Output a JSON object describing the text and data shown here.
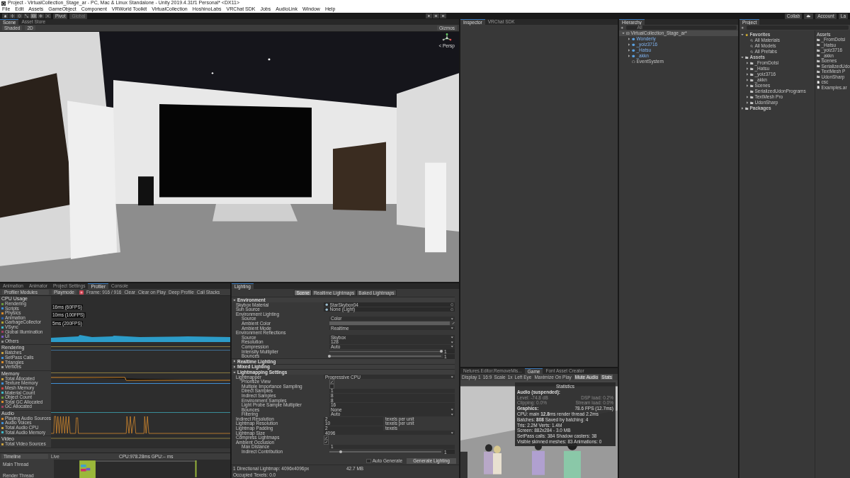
{
  "window": {
    "title": "Project - VirtualCollection_Stage_ar - PC, Mac & Linux Standalone - Unity 2019.4.31f1 Personal* <DX11>"
  },
  "menu": [
    "File",
    "Edit",
    "Assets",
    "GameObject",
    "Component",
    "VRWorld Toolkit",
    "VirtualCollection",
    "HoshinoLabs",
    "VRChat SDK",
    "Jobs",
    "AudioLink",
    "Window",
    "Help"
  ],
  "toolbar": {
    "tools": [
      {
        "kind": "hand",
        "selected": false
      },
      {
        "kind": "move",
        "selected": false
      },
      {
        "kind": "rotate",
        "selected": false
      },
      {
        "kind": "scale",
        "selected": false
      },
      {
        "kind": "rect",
        "selected": true
      },
      {
        "kind": "transform",
        "selected": false
      },
      {
        "kind": "custom",
        "selected": false
      }
    ],
    "pivot": "Pivot",
    "space": "Global",
    "collab": "Collab",
    "account": "Account",
    "layers": "La"
  },
  "scene": {
    "tabs": [
      {
        "label": "Scene",
        "selected": true
      },
      {
        "label": "Asset Store",
        "selected": false
      }
    ],
    "shading": "Shaded",
    "mode_2d": "2D",
    "gizmos": "Gizmos",
    "view": "< Persp"
  },
  "profiler": {
    "tabs": [
      {
        "label": "Animation",
        "selected": false
      },
      {
        "label": "Animator",
        "selected": false
      },
      {
        "label": "Project Settings",
        "selected": false
      },
      {
        "label": "Profiler",
        "selected": true
      },
      {
        "label": "Console",
        "selected": false
      }
    ],
    "toolbar": {
      "modules": "Profiler Modules",
      "target": "Playmode",
      "frame": "Frame: 916 / 916",
      "buttons": [
        "Clear",
        "Clear on Play",
        "Deep Profile",
        "Call Stacks"
      ]
    },
    "modules": [
      {
        "kind": "cpu",
        "title": "CPU Usage",
        "items": [
          {
            "label": "Rendering",
            "color": "#6b9a3c"
          },
          {
            "label": "Scripts",
            "color": "#3f8fd6"
          },
          {
            "label": "Physics",
            "color": "#d68a2c"
          },
          {
            "label": "Animation",
            "color": "#2a5fa8"
          },
          {
            "label": "GarbageCollector",
            "color": "#b0a030"
          },
          {
            "label": "VSync",
            "color": "#3fb8c8"
          },
          {
            "label": "Global Illumination",
            "color": "#a04060"
          },
          {
            "label": "UI",
            "color": "#7a5ac8"
          },
          {
            "label": "Others",
            "color": "#909090"
          }
        ],
        "marks": [
          "16ms (60FPS)",
          "10ms (100FPS)",
          "5ms (200FPS)"
        ]
      },
      {
        "kind": "rendering",
        "title": "Rendering",
        "items": [
          {
            "label": "Batches",
            "color": "#c8a040"
          },
          {
            "label": "SetPass Calls",
            "color": "#3f8fd6"
          },
          {
            "label": "Triangles",
            "color": "#d68a2c"
          },
          {
            "label": "Vertices",
            "color": "#a0a0a0"
          }
        ]
      },
      {
        "kind": "memory",
        "title": "Memory",
        "items": [
          {
            "label": "Total Allocated",
            "color": "#c8a040"
          },
          {
            "label": "Texture Memory",
            "color": "#3f8fd6"
          },
          {
            "label": "Mesh Memory",
            "color": "#d04040"
          },
          {
            "label": "Material Count",
            "color": "#3fb8c8"
          },
          {
            "label": "Object Count",
            "color": "#6b9a3c"
          },
          {
            "label": "Total GC Allocated",
            "color": "#d68a2c"
          },
          {
            "label": "GC Allocated",
            "color": "#a04060"
          }
        ]
      },
      {
        "kind": "audio",
        "title": "Audio",
        "items": [
          {
            "label": "Playing Audio Sources",
            "color": "#d68a2c"
          },
          {
            "label": "Audio Voices",
            "color": "#3f8fd6"
          },
          {
            "label": "Total Audio CPU",
            "color": "#c8a040"
          },
          {
            "label": "Total Audio Memory",
            "color": "#3fb8c8"
          }
        ]
      },
      {
        "kind": "video",
        "title": "Video",
        "items": [
          {
            "label": "Total Video Sources",
            "color": "#c8a040"
          }
        ]
      }
    ],
    "timeline": {
      "view": "Timeline",
      "mode": "Live",
      "summary": "CPU:978.28ms  GPU:-- ms",
      "threads": [
        "Main Thread",
        "Render Thread"
      ]
    }
  },
  "lighting": {
    "tab": "Lighting",
    "subtabs": [
      {
        "label": "Scene",
        "selected": true
      },
      {
        "label": "Realtime Lightmaps",
        "selected": false
      },
      {
        "label": "Baked Lightmaps",
        "selected": false
      }
    ],
    "sections": [
      {
        "title": "Environment",
        "expanded": true,
        "rows": [
          {
            "kind": "object",
            "label": "Skybox Material",
            "value": "StarSkybox04"
          },
          {
            "kind": "object",
            "label": "Sun Source",
            "value": "None (Light)"
          },
          {
            "kind": "label",
            "label": "Environment Lighting",
            "children": [
              {
                "kind": "dropdown",
                "label": "Source",
                "value": "Color"
              },
              {
                "kind": "color",
                "label": "Ambient Color"
              },
              {
                "kind": "dropdown",
                "label": "Ambient Mode",
                "value": "Realtime"
              }
            ]
          },
          {
            "kind": "label",
            "label": "Environment Reflections",
            "children": [
              {
                "kind": "dropdown",
                "label": "Source",
                "value": "Skybox"
              },
              {
                "kind": "dropdown",
                "label": "Resolution",
                "value": "128"
              },
              {
                "kind": "dropdown",
                "label": "Compression",
                "value": "Auto"
              },
              {
                "kind": "slider",
                "label": "Intensity Multiplier",
                "level": 1,
                "value": "1"
              },
              {
                "kind": "slider",
                "label": "Bounces",
                "level": 0,
                "value": "1"
              }
            ]
          }
        ]
      },
      {
        "title": "Realtime Lighting",
        "expanded": false
      },
      {
        "title": "Mixed Lighting",
        "expanded": false
      },
      {
        "title": "Lightmapping Settings",
        "expanded": true,
        "rows": [
          {
            "kind": "dropdown",
            "label": "Lightmapper",
            "value": "Progressive CPU",
            "children": [
              {
                "kind": "check",
                "label": "Prioritize View",
                "checked": true
              },
              {
                "kind": "check",
                "label": "Multiple Importance Sampling",
                "checked": false
              },
              {
                "kind": "number",
                "label": "Direct Samples",
                "value": "1"
              },
              {
                "kind": "number",
                "label": "Indirect Samples",
                "value": "8"
              },
              {
                "kind": "number",
                "label": "Environment Samples",
                "value": "8"
              },
              {
                "kind": "number",
                "label": "Light Probe Sample Multiplier",
                "value": "16"
              },
              {
                "kind": "dropdown",
                "label": "Bounces",
                "value": "None"
              },
              {
                "kind": "dropdown",
                "label": "Filtering",
                "value": "Auto"
              }
            ]
          },
          {
            "kind": "unit",
            "label": "Indirect Resolution",
            "value": "2",
            "unit": "texels per unit"
          },
          {
            "kind": "unit",
            "label": "Lightmap Resolution",
            "value": "10",
            "unit": "texels per unit"
          },
          {
            "kind": "unit",
            "label": "Lightmap Padding",
            "value": "2",
            "unit": "texels"
          },
          {
            "kind": "dropdown",
            "label": "Lightmap Size",
            "value": "4096"
          },
          {
            "kind": "check",
            "label": "Compress Lightmaps",
            "checked": true
          },
          {
            "kind": "check",
            "label": "Ambient Occlusion",
            "checked": true,
            "children": [
              {
                "kind": "number",
                "label": "Max Distance",
                "value": "1"
              },
              {
                "kind": "slider",
                "label": "Indirect Contribution",
                "level": 0.1,
                "value": "1"
              }
            ]
          }
        ]
      }
    ],
    "auto_generate": {
      "label": "Auto Generate",
      "checked": false
    },
    "generate": "Generate Lighting",
    "stats": [
      "1 Directional Lightmap: 4096x4096px",
      "42.7 MB"
    ],
    "occupied": "Occupied Texels: 0.0"
  },
  "inspector": {
    "tabs": [
      {
        "label": "Inspector",
        "selected": true
      },
      {
        "label": "VRChat SDK",
        "selected": false
      }
    ]
  },
  "game": {
    "tabs": [
      {
        "label": "Netures.Editor.RemoveMis...",
        "selected": false
      },
      {
        "label": "Game",
        "selected": true
      },
      {
        "label": "Font Asset Creator",
        "selected": false
      }
    ],
    "display": "Display 1",
    "aspect": "16:9",
    "scale_label": "Scale",
    "scale": "1x",
    "eye": "Left Eye",
    "toggles": [
      {
        "label": "Maximize On Play",
        "selected": false
      },
      {
        "label": "Mute Audio",
        "selected": true
      },
      {
        "label": "Stats",
        "selected": true
      }
    ],
    "stats": {
      "title": "Statistics",
      "lines": [
        {
          "kind": "heading",
          "text": "Audio (suspended):"
        },
        {
          "kind": "pair",
          "left": "Level: -74.8 dB",
          "right": "DSP load: 0.2%",
          "dim": true
        },
        {
          "kind": "pair",
          "left": "Clipping: 0.0%",
          "right": "Stream load: 0.0%",
          "dim": true
        },
        {
          "kind": "pair",
          "left": "Graphics:",
          "right": "78.6 FPS (12.7ms)",
          "dim": false
        },
        {
          "kind": "line",
          "text": "CPU: main **12.8**ms  render thread 2.2ms"
        },
        {
          "kind": "line",
          "text": "Batches: **808**   Saved by batching: 4"
        },
        {
          "kind": "line",
          "text": "Tris: 2.2M   Verts: 1.4M"
        },
        {
          "kind": "line",
          "text": "Screen: 882x284 - 3.0 MB"
        },
        {
          "kind": "line",
          "text": "SetPass calls: 384   Shadow casters: 38"
        },
        {
          "kind": "line",
          "text": "Visible skinned meshes: 83  Animations: 0"
        }
      ]
    }
  },
  "hierarchy": {
    "tab": "Hierarchy",
    "search": "All",
    "tree": [
      {
        "kind": "scene",
        "label": "VirtualCollection_Stage_ar*",
        "expanded": true,
        "children": [
          {
            "kind": "prefab",
            "label": "Wonderly",
            "expanded": false
          },
          {
            "kind": "prefab",
            "label": "_yoiz3716",
            "expanded": false
          },
          {
            "kind": "prefab",
            "label": "_Hatsu",
            "expanded": false
          },
          {
            "kind": "prefab",
            "label": "_akkn",
            "expanded": false
          },
          {
            "kind": "object",
            "label": "EventSystem"
          }
        ]
      }
    ]
  },
  "project": {
    "tab": "Project",
    "tree": [
      {
        "kind": "star",
        "label": "Favorites",
        "expanded": true,
        "children": [
          {
            "kind": "search",
            "label": "All Materials"
          },
          {
            "kind": "search",
            "label": "All Models"
          },
          {
            "kind": "search",
            "label": "All Prefabs"
          }
        ]
      },
      {
        "kind": "folder",
        "label": "Assets",
        "expanded": true,
        "children": [
          {
            "kind": "folder",
            "label": "_FromDotsi",
            "expanded": false
          },
          {
            "kind": "folder",
            "label": "_Hatsu",
            "expanded": false
          },
          {
            "kind": "folder",
            "label": "_yoiz3716",
            "expanded": false
          },
          {
            "kind": "folder",
            "label": "_akkn",
            "expanded": false
          },
          {
            "kind": "folder",
            "label": "Scenes",
            "expanded": false
          },
          {
            "kind": "folder",
            "label": "SerializedUdonPrograms"
          },
          {
            "kind": "folder",
            "label": "TextMesh Pro",
            "expanded": false
          },
          {
            "kind": "folder",
            "label": "UdonSharp",
            "expanded": false
          }
        ]
      },
      {
        "kind": "folder",
        "label": "Packages",
        "expanded": false
      }
    ],
    "column_title": "Assets",
    "items": [
      {
        "kind": "folder",
        "label": "_FromDotsi"
      },
      {
        "kind": "folder",
        "label": "_Hatsu"
      },
      {
        "kind": "folder",
        "label": "_yoiz3716"
      },
      {
        "kind": "folder",
        "label": "_akkn"
      },
      {
        "kind": "folder",
        "label": "Scenes"
      },
      {
        "kind": "folder",
        "label": "SerializedUdo"
      },
      {
        "kind": "folder",
        "label": "TextMesh P"
      },
      {
        "kind": "folder",
        "label": "UdonSharp"
      },
      {
        "kind": "file",
        "label": "csc"
      },
      {
        "kind": "file",
        "label": "Examples.ar"
      }
    ]
  }
}
